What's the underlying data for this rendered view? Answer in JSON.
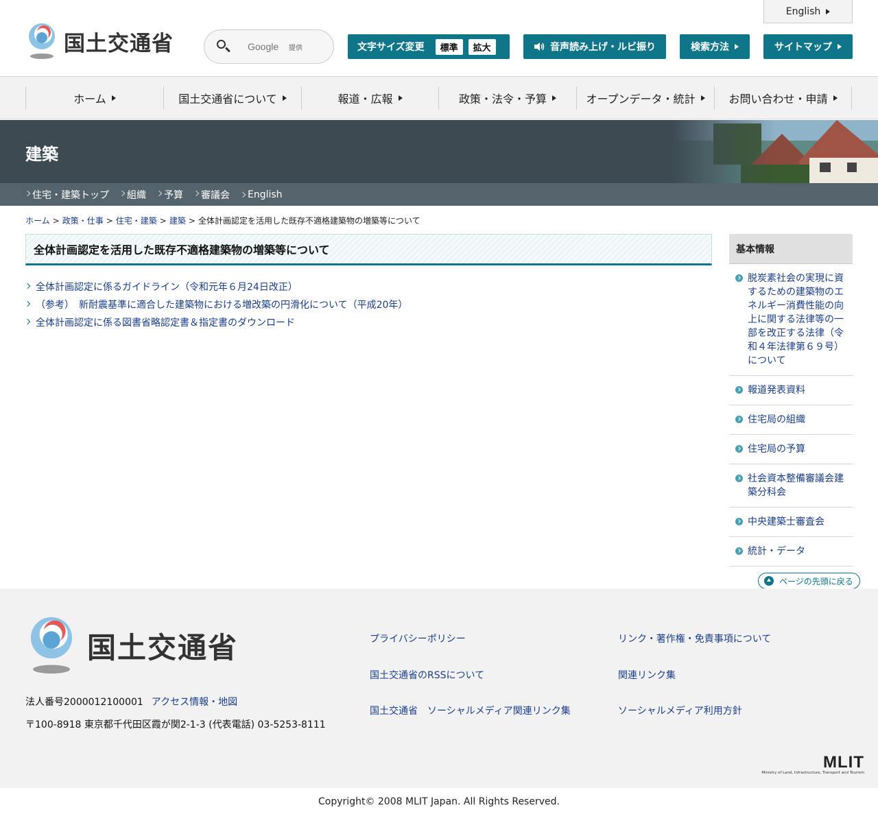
{
  "header": {
    "logo_text": "国土交通省",
    "lang_link": "English",
    "search": {
      "placeholder": "Google",
      "provider": "提供"
    },
    "font_size": {
      "label": "文字サイズ変更",
      "options": [
        "標準",
        "拡大"
      ]
    },
    "read_aloud": "音声読み上げ・ルビ振り",
    "search_method": "検索方法",
    "sitemap": "サイトマップ"
  },
  "nav": {
    "items": [
      "ホーム",
      "国土交通省について",
      "報道・広報",
      "政策・法令・予算",
      "オープンデータ・統計",
      "お問い合わせ・申請"
    ]
  },
  "category": {
    "title": "建築",
    "subnav": [
      "住宅・建築トップ",
      "組織",
      "予算",
      "審議会",
      "English"
    ]
  },
  "breadcrumb": {
    "links": [
      "ホーム",
      "政策・仕事",
      "住宅・建築",
      "建築"
    ],
    "current": "全体計画認定を活用した既存不適格建築物の増築等について"
  },
  "main": {
    "title": "全体計画認定を活用した既存不適格建築物の増築等について",
    "links": [
      "全体計画認定に係るガイドライン（令和元年６月24日改正）",
      "（参考）　新耐震基準に適合した建築物における増改築の円滑化について（平成20年）",
      "全体計画認定に係る図書省略認定書＆指定書のダウンロード"
    ]
  },
  "sidebar": {
    "heading": "基本情報",
    "items": [
      "脱炭素社会の実現に資するための建築物のエネルギー消費性能の向上に関する法律等の一部を改正する法律（令和４年法律第６９号）について",
      "報道発表資料",
      "住宅局の組織",
      "住宅局の予算",
      "社会資本整備審議会建築分科会",
      "中央建築士審査会",
      "統計・データ"
    ]
  },
  "page_top": "ページの先頭に戻る",
  "footer": {
    "logo_text": "国土交通省",
    "corp_number": "法人番号2000012100001",
    "access_link": "アクセス情報・地図",
    "address": "〒100-8918 東京都千代田区霞が関2-1-3 (代表電話) 03-5253-8111",
    "links_col1": [
      "プライバシーポリシー",
      "国土交通省のRSSについて",
      "国土交通省　ソーシャルメディア関連リンク集"
    ],
    "links_col2": [
      "リンク・著作権・免責事項について",
      "関連リンク集",
      "ソーシャルメディア利用方針"
    ],
    "mlit_logo": "MLIT",
    "mlit_sub": "Ministry of Land, Infrastructure, Transport and Tourism",
    "copyright": "Copyright© 2008 MLIT Japan. All Rights Reserved."
  },
  "colors": {
    "teal": "#0f7689",
    "banner": "#3e4a52",
    "subnav": "#55646c",
    "link": "#1a3e8a"
  }
}
